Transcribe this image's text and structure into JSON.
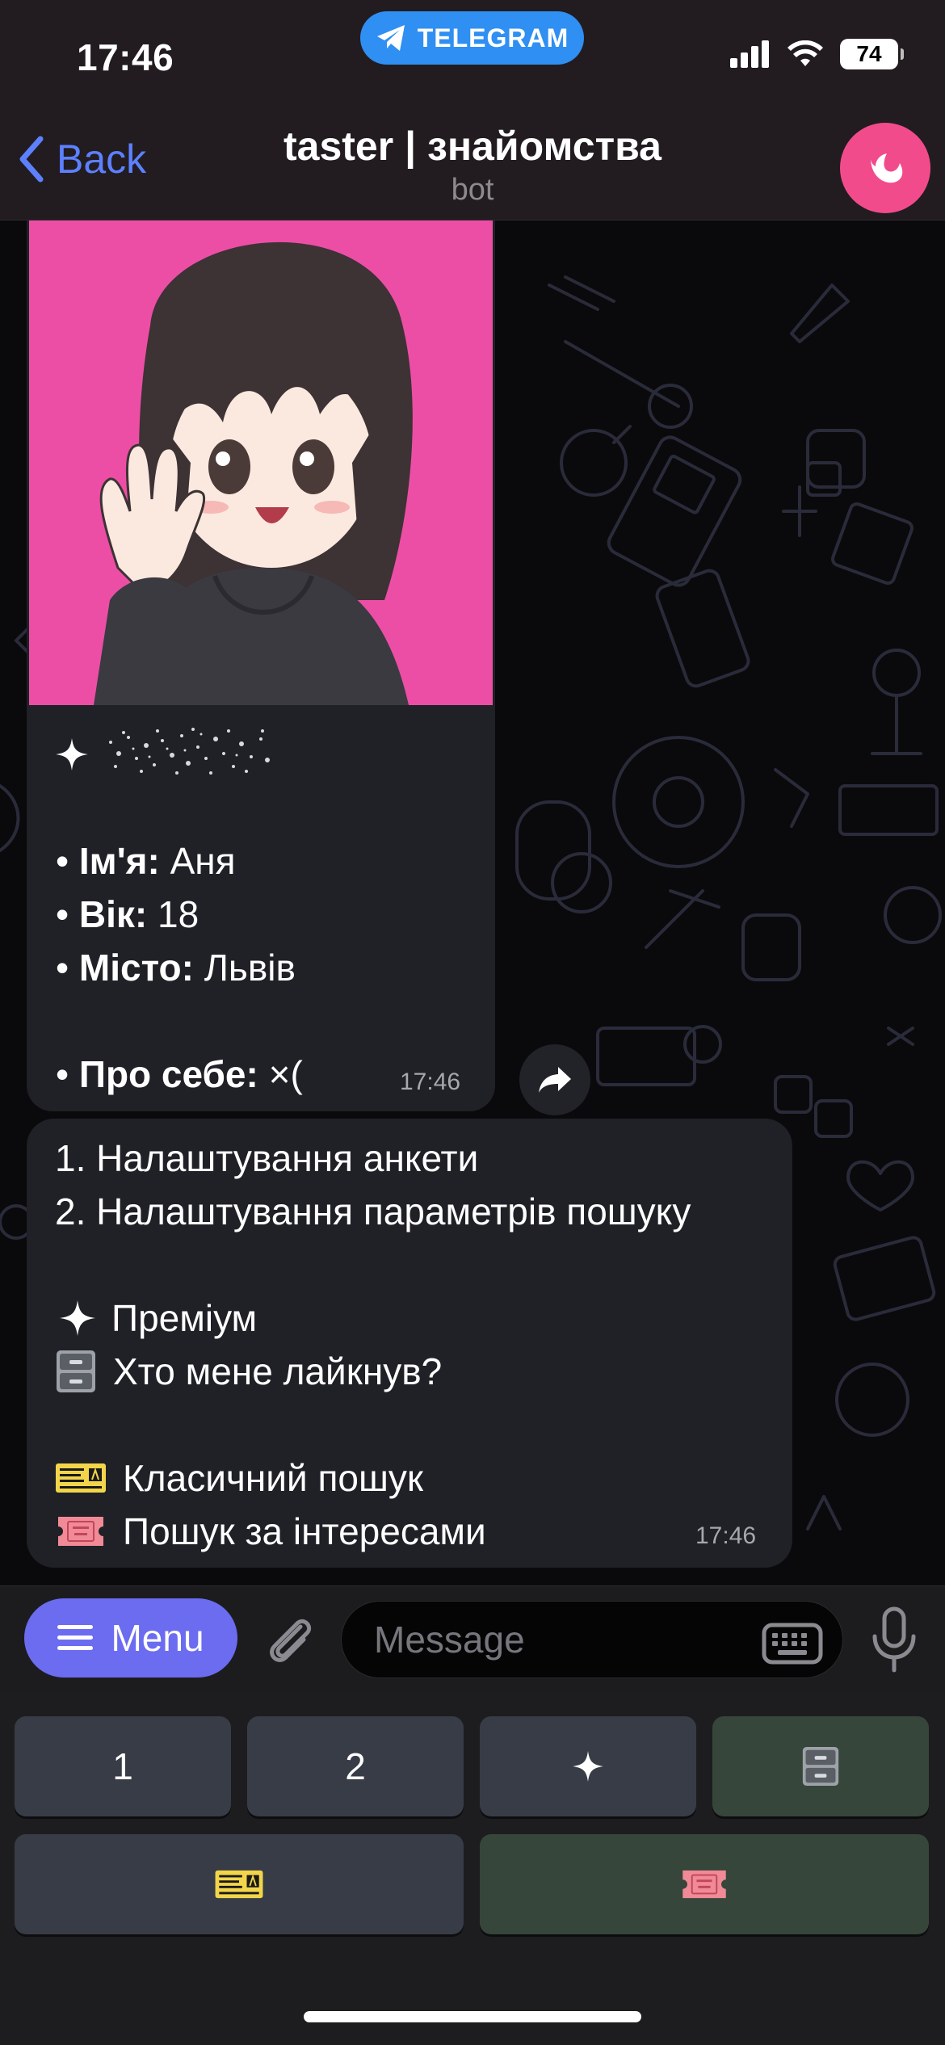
{
  "status_bar": {
    "time": "17:46",
    "pill_label": "TELEGRAM",
    "battery": "74"
  },
  "header": {
    "back_label": "Back",
    "title": "taster | знайомства",
    "subtitle": "bot"
  },
  "profile_message": {
    "name_label": "Ім'я:",
    "name_value": " Аня",
    "age_label": "Вік:",
    "age_value": " 18",
    "city_label": "Місто:",
    "city_value": " Львів",
    "about_label": "Про себе:",
    "about_value": " ×(",
    "time": "17:46"
  },
  "menu_message": {
    "lines": [
      "1. Налаштування анкети",
      "2. Налаштування параметрів пошуку",
      "Преміум",
      "Хто мене лайкнув?",
      "Класичний пошук",
      "Пошук за інтересами"
    ],
    "time": "17:46"
  },
  "input": {
    "menu_label": "Menu",
    "placeholder": "Message"
  },
  "keyboard": {
    "key1": "1",
    "key2": "2"
  },
  "icons": [
    "telegram-icon",
    "back-chevron-icon",
    "sparkle-icon",
    "cabinet-icon",
    "ticket-icon",
    "admit-ticket-icon",
    "paperclip-icon",
    "keyboard-icon",
    "mic-icon",
    "forward-icon"
  ],
  "colors": {
    "accent": "#5d80ff",
    "pill": "#2f8ff2",
    "menu_button": "#6b6cf0",
    "bot_avatar": "#f24b8c",
    "photo_bg": "#ec4ea6"
  }
}
